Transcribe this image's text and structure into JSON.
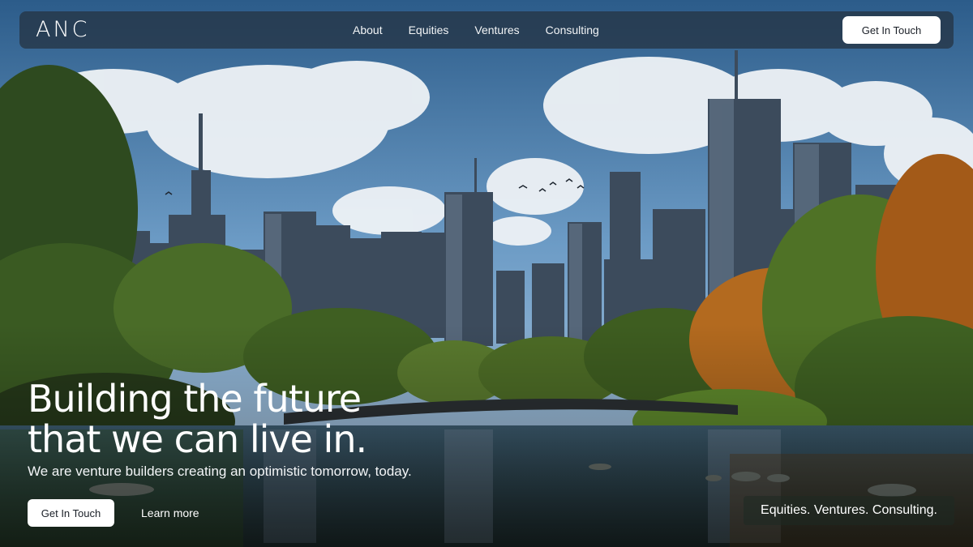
{
  "nav": {
    "logo_text": "ANC",
    "links": [
      "About",
      "Equities",
      "Ventures",
      "Consulting"
    ],
    "cta_label": "Get In Touch"
  },
  "hero": {
    "image_description_icon": "city-skyline-park-image",
    "headline_line1": "Building the future",
    "headline_line2": "that we can live in.",
    "subheadline": "We are venture builders creating an optimistic tomorrow, today.",
    "primary_button": "Get In Touch",
    "secondary_button": "Learn more",
    "tagline": "Equities. Ventures. Consulting."
  },
  "colors": {
    "nav_background": "#24303e",
    "button_background": "#ffffff",
    "button_text": "#1a1f27"
  }
}
